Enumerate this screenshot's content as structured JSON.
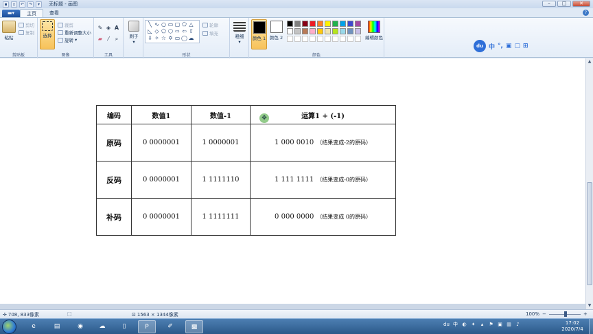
{
  "window": {
    "title": "无标题 - 画图",
    "controls": {
      "minimize": "–",
      "maximize": "□",
      "close": "✕"
    }
  },
  "tabs": [
    {
      "label": "主页",
      "active": true
    },
    {
      "label": "查看",
      "active": false
    }
  ],
  "ribbon": {
    "clipboard": {
      "label": "剪贴板",
      "paste": "粘贴",
      "cut": "剪切",
      "copy": "复制"
    },
    "image": {
      "label": "图像",
      "select": "选择",
      "crop": "裁剪",
      "resize": "重新调整大小",
      "rotate": "旋转"
    },
    "tools": {
      "label": "工具"
    },
    "brushes": {
      "label": "刷子"
    },
    "shapes": {
      "label": "形状",
      "outline": "轮廓",
      "fill": "填充"
    },
    "size": {
      "label": "粗细"
    },
    "colors": {
      "label": "颜色",
      "color1": "颜色 1",
      "color2": "颜色 2",
      "edit": "编辑颜色",
      "palette_row1": [
        "#000000",
        "#7f7f7f",
        "#880015",
        "#ed1c24",
        "#ff7f27",
        "#fff200",
        "#22b14c",
        "#00a2e8",
        "#3f48cc",
        "#a349a4"
      ],
      "palette_row2": [
        "#ffffff",
        "#c3c3c3",
        "#b97a57",
        "#ffaec9",
        "#ffc90e",
        "#efe4b0",
        "#b5e61d",
        "#99d9ea",
        "#7092be",
        "#c8bfe7"
      ]
    }
  },
  "ime": {
    "logo": "du",
    "mode": "中",
    "punct": "°,",
    "items": [
      "▣",
      "▢",
      "⊞"
    ]
  },
  "table": {
    "headers": [
      "编码",
      "数值1",
      "数值-1",
      "运算1 + (-1)"
    ],
    "rows": [
      {
        "name": "原码",
        "v1": "0 0000001",
        "v2": "1 0000001",
        "op": "1 000 0010",
        "note": "（结果变成-2的原码）"
      },
      {
        "name": "反码",
        "v1": "0 0000001",
        "v2": "1 1111110",
        "op": "1 111 1111",
        "note": "（结果变成-0的原码）"
      },
      {
        "name": "补码",
        "v1": "0 0000001",
        "v2": "1 1111111",
        "op": "0 000 0000",
        "note": "（结果变成 0的原码）"
      }
    ]
  },
  "status": {
    "cursor_pos": "708, 833像素",
    "canvas_size": "1563 × 1344像素",
    "zoom": "100%"
  },
  "taskbar": {
    "time": "17:02",
    "date": "2020/7/4"
  }
}
